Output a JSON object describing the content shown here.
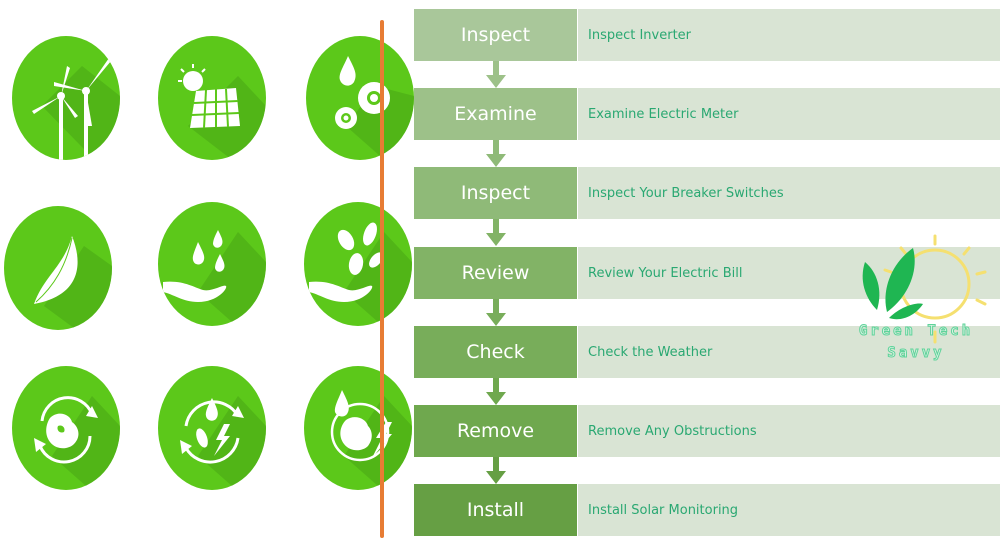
{
  "icons": [
    {
      "name": "wind-turbine-icon"
    },
    {
      "name": "solar-panel-icon"
    },
    {
      "name": "water-gears-icon"
    },
    {
      "name": "leaf-icon"
    },
    {
      "name": "hand-water-drops-icon"
    },
    {
      "name": "hand-leaves-icon"
    },
    {
      "name": "earth-recycle-icon"
    },
    {
      "name": "water-leaf-energy-cycle-icon"
    },
    {
      "name": "earth-water-energy-icon"
    }
  ],
  "steps": [
    {
      "label": "Inspect",
      "description": "Inspect Inverter",
      "color": "#a9c79a"
    },
    {
      "label": "Examine",
      "description": "Examine Electric Meter",
      "color": "#9dc189"
    },
    {
      "label": "Inspect",
      "description": "Inspect Your Breaker Switches",
      "color": "#8fba78"
    },
    {
      "label": "Review",
      "description": "Review Your Electric Bill",
      "color": "#82b366"
    },
    {
      "label": "Check",
      "description": "Check the Weather",
      "color": "#78ad5a"
    },
    {
      "label": "Remove",
      "description": "Remove Any Obstructions",
      "color": "#6fa84e"
    },
    {
      "label": "Install",
      "description": "Install Solar Monitoring",
      "color": "#669f44"
    }
  ],
  "logo": {
    "line1": "Green Tech",
    "line2": "Savvy"
  },
  "colors": {
    "icon_green": "#5cc81a",
    "divider": "#e77c34",
    "desc_bg": "#d9e4d4",
    "desc_text": "#2aa872"
  }
}
